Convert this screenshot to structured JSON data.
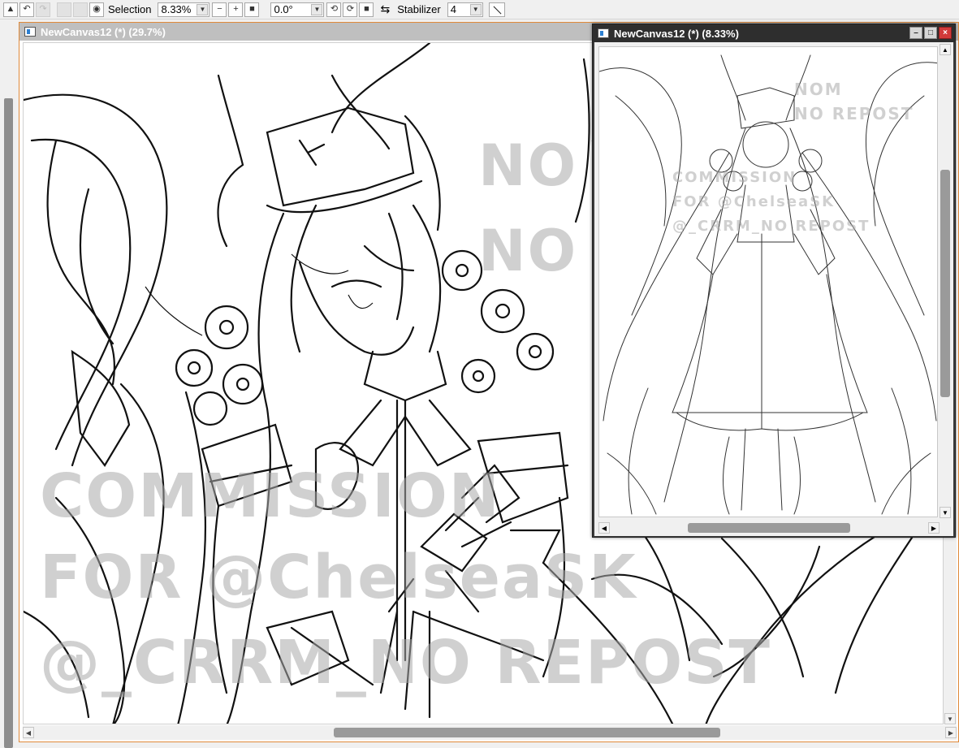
{
  "toolbar": {
    "selection_label": "Selection",
    "zoom_value": "8.33%",
    "rotation_value": "0.0°",
    "stabilizer_label": "Stabilizer",
    "stabilizer_value": "4"
  },
  "main_window": {
    "title": "NewCanvas12 (*) (29.7%)",
    "watermarks": [
      "NO",
      "NO",
      "COMMISSION",
      "FOR @ChelseaSK",
      "@_CRRM_NO REPOST"
    ]
  },
  "navigator_window": {
    "title": "NewCanvas12 (*) (8.33%)",
    "watermarks": [
      "NOM",
      "NO REPOST",
      "COMMISSION",
      "FOR @ChelseaSK",
      "@_CRRM_NO REPOST"
    ],
    "controls": {
      "minimize": "–",
      "maximize": "□",
      "close": "×"
    }
  },
  "icons": [
    "undo-icon",
    "redo-icon",
    "eye-icon",
    "zoom-out-icon",
    "zoom-in-icon",
    "zoom-reset-icon",
    "rotate-left-icon",
    "rotate-right-icon",
    "rotate-reset-icon",
    "flip-icon",
    "line-tool-icon"
  ],
  "colors": {
    "active_border": "#e08a3a",
    "close_button": "#d23a3a",
    "title_inactive": "#bfbfbf",
    "title_dark": "#2e2e2e"
  }
}
